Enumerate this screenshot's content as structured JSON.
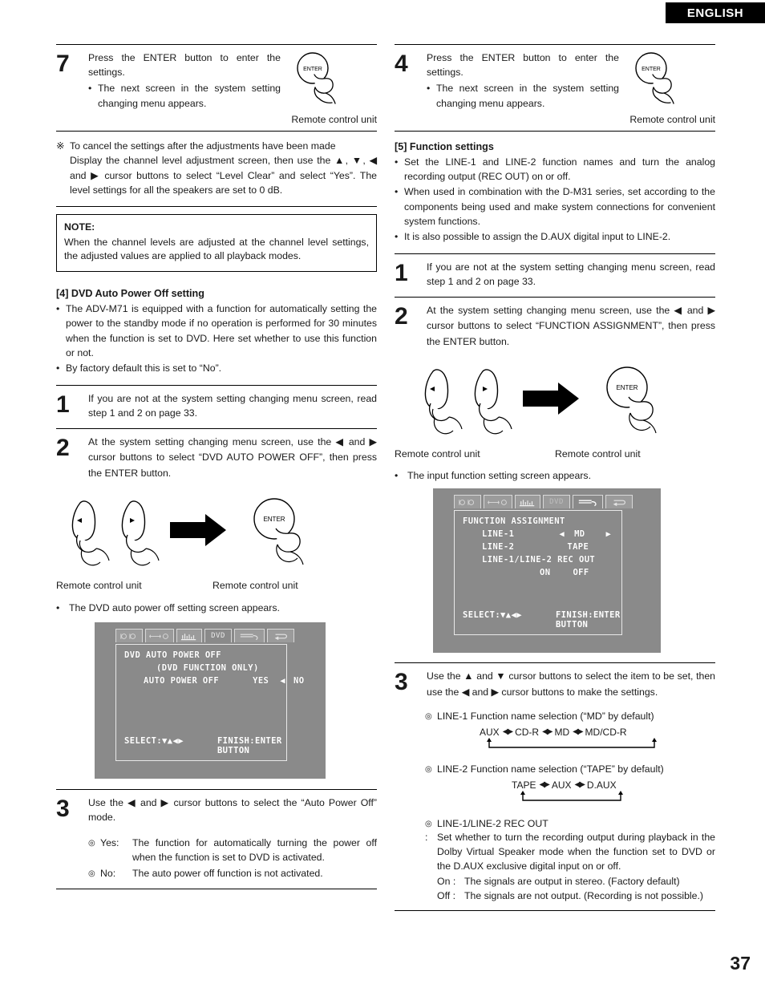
{
  "header": {
    "language": "ENGLISH"
  },
  "footer": {
    "page_number": "37"
  },
  "left_column": {
    "step7": {
      "number": "7",
      "line1": "Press the ENTER button to enter the settings.",
      "bullet": "The next screen in the system setting changing menu appears.",
      "remote_label": "Remote control unit",
      "enter_label": "ENTER"
    },
    "star_note": {
      "mark": "※",
      "line1": "To cancel the settings after the adjustments have been made",
      "line2": "Display the channel level adjustment screen, then use the ▲, ▼, ◀ and ▶ cursor buttons to select “Level Clear” and select “Yes”. The level settings for all the speakers are set to 0 dB."
    },
    "note_box": {
      "title": "NOTE:",
      "text": "When the channel levels are adjusted at the channel level settings, the adjusted values are applied to all playback modes."
    },
    "section": {
      "heading": "[4]  DVD Auto Power Off setting",
      "bullets": [
        "The ADV-M71 is equipped with a function for automatically setting the power to the standby mode if no operation is performed for 30 minutes when the function is set to DVD. Here set whether to use this function or not.",
        "By factory default this is set to “No”."
      ]
    },
    "step1": {
      "number": "1",
      "text": "If you are not at the system setting changing menu screen, read step 1 and 2 on page 33."
    },
    "step2": {
      "number": "2",
      "text": "At the system setting changing menu screen, use the ◀ and ▶ cursor buttons to select “DVD AUTO POWER OFF”, then press the ENTER button.",
      "remote_label_left": "Remote control unit",
      "remote_label_right": "Remote control unit",
      "enter_label": "ENTER",
      "result_bullet": "The DVD auto power off setting screen appears."
    },
    "osd": {
      "tabs": [
        {
          "icon": "speaker-pair-icon",
          "label": "",
          "active": false
        },
        {
          "icon": "speaker-distance-icon",
          "label": "",
          "active": false
        },
        {
          "icon": "level-meter-icon",
          "label": "",
          "active": false
        },
        {
          "icon": "dvd-text",
          "label": "DVD",
          "active": true
        },
        {
          "icon": "connector-icon",
          "label": "",
          "active": false
        },
        {
          "icon": "return-arrow-icon",
          "label": "",
          "active": false
        }
      ],
      "title": "DVD AUTO POWER OFF",
      "subtitle": "(DVD FUNCTION ONLY)",
      "row_label": "AUTO POWER OFF",
      "option_yes": "YES",
      "cursor": "◀",
      "option_no": "NO",
      "footer_select": "SELECT:▼▲◀▶",
      "footer_finish": "FINISH:ENTER BUTTON"
    },
    "step3": {
      "number": "3",
      "text": "Use the ◀ and ▶ cursor buttons to select the “Auto Power Off” mode.",
      "options": [
        {
          "mark": "◎",
          "label": "Yes:",
          "text": "The function for automatically turning the power off when the function is set to DVD is activated."
        },
        {
          "mark": "◎",
          "label": "No:",
          "text": "The auto power off function is not activated."
        }
      ]
    }
  },
  "right_column": {
    "step4": {
      "number": "4",
      "line1": "Press the ENTER button to enter the settings.",
      "bullet": "The next screen in the system setting changing menu appears.",
      "remote_label": "Remote control unit",
      "enter_label": "ENTER"
    },
    "section": {
      "heading": "[5]  Function settings",
      "bullets": [
        "Set the LINE-1 and LINE-2 function names and turn the analog recording output (REC OUT) on or off.",
        "When used in combination with the D-M31 series, set according to the components being used and make system connections for convenient system functions.",
        "It is also possible to assign the D.AUX digital input to LINE-2."
      ]
    },
    "step1": {
      "number": "1",
      "text": "If you are not at the system setting changing menu screen, read step 1 and 2 on page 33."
    },
    "step2": {
      "number": "2",
      "text": "At the system setting changing menu screen, use the ◀ and ▶ cursor buttons to select “FUNCTION ASSIGNMENT”, then press the ENTER button.",
      "remote_label_left": "Remote control unit",
      "remote_label_right": "Remote control unit",
      "enter_label": "ENTER",
      "result_bullet": "The input function setting screen appears."
    },
    "osd": {
      "tabs": [
        {
          "icon": "speaker-pair-icon",
          "label": "",
          "active": false
        },
        {
          "icon": "speaker-distance-icon",
          "label": "",
          "active": false
        },
        {
          "icon": "level-meter-icon",
          "label": "",
          "active": false
        },
        {
          "icon": "dvd-text",
          "label": "DVD",
          "active": false
        },
        {
          "icon": "connector-icon",
          "label": "",
          "active": true
        },
        {
          "icon": "return-arrow-icon",
          "label": "",
          "active": false
        }
      ],
      "title": "FUNCTION ASSIGNMENT",
      "row1_label": "LINE-1",
      "row1_left_cursor": "◀",
      "row1_value": "MD",
      "row1_right_cursor": "▶",
      "row2_label": "LINE-2",
      "row2_value": "TAPE",
      "row3_label": "LINE-1/LINE-2 REC OUT",
      "row3_on": "ON",
      "row3_off": "OFF",
      "footer_select": "SELECT:▼▲◀▶",
      "footer_finish": "FINISH:ENTER BUTTON"
    },
    "step3": {
      "number": "3",
      "text": "Use the ▲ and ▼ cursor buttons to select the item to be set, then use the ◀ and ▶ cursor buttons to make the settings.",
      "line1_heading_mark": "◎",
      "line1_heading": "LINE-1  Function name selection (“MD” by default)",
      "line1_chain": [
        "AUX",
        "CD-R",
        "MD",
        "MD/CD-R"
      ],
      "line2_heading_mark": "◎",
      "line2_heading": "LINE-2  Function name selection (“TAPE” by default)",
      "line2_chain": [
        "TAPE",
        "AUX",
        "D.AUX"
      ],
      "recout_mark": "◎",
      "recout_heading": "LINE-1/LINE-2 REC OUT",
      "recout_colon": ":",
      "recout_text": "Set whether to turn the recording output during playback in the Dolby Virtual Speaker mode when the function set to DVD or the D.AUX exclusive digital input on or off.",
      "recout_options": [
        {
          "label": "On :",
          "text": "The signals are output in stereo. (Factory default)"
        },
        {
          "label": "Off :",
          "text": "The signals are not output. (Recording is not possible.)"
        }
      ]
    }
  }
}
